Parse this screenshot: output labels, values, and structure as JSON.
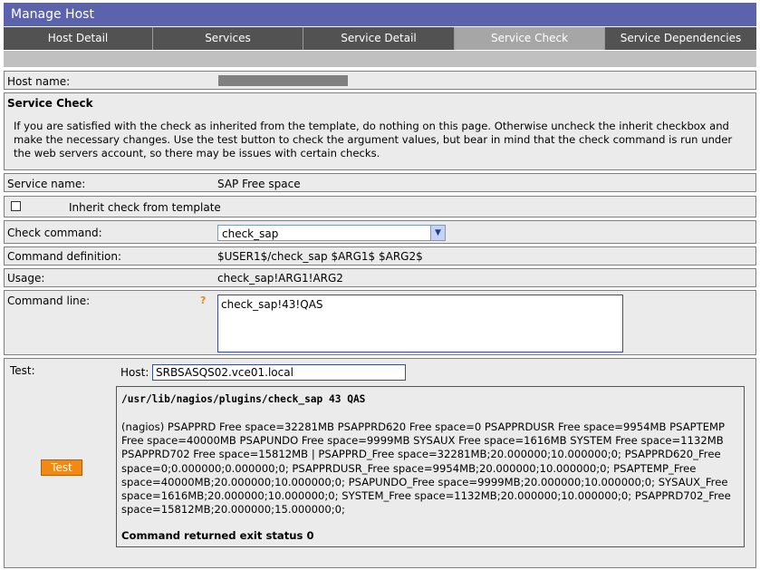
{
  "window": {
    "title": "Manage Host"
  },
  "tabs": [
    {
      "label": "Host Detail",
      "active": false
    },
    {
      "label": "Services",
      "active": false
    },
    {
      "label": "Service Detail",
      "active": false
    },
    {
      "label": "Service Check",
      "active": true
    },
    {
      "label": "Service Dependencies",
      "active": false
    }
  ],
  "host": {
    "label": "Host name:"
  },
  "service_check": {
    "title": "Service Check",
    "description": "If you are satisfied with the check as inherited from the template, do nothing on this page. Otherwise uncheck the inherit checkbox and make the necessary changes. Use the test button to check the argument values, but bear in mind that the check command is run under the web servers account, so there may be issues with certain checks."
  },
  "service_name": {
    "label": "Service name:",
    "value": "SAP Free space"
  },
  "inherit": {
    "label": "Inherit check from template",
    "checked": false
  },
  "check_command": {
    "label": "Check command:",
    "value": "check_sap"
  },
  "command_definition": {
    "label": "Command definition:",
    "value": "$USER1$/check_sap $ARG1$ $ARG2$"
  },
  "usage": {
    "label": "Usage:",
    "value": "check_sap!ARG1!ARG2"
  },
  "command_line": {
    "label": "Command line:",
    "help": "?",
    "value": "check_sap!43!QAS"
  },
  "test": {
    "label": "Test:",
    "host_label": "Host:",
    "host_value": "SRBSASQS02.vce01.local",
    "button_label": "Test",
    "output_path": "/usr/lib/nagios/plugins/check_sap 43 QAS",
    "output_text": "(nagios) PSAPPRD Free space=32281MB PSAPPRD620 Free space=0 PSAPPRDUSR Free space=9954MB PSAPTEMP Free space=40000MB PSAPUNDO Free space=9999MB SYSAUX Free space=1616MB SYSTEM Free space=1132MB PSAPPRD702 Free space=15812MB | PSAPPRD_Free space=32281MB;20.000000;10.000000;0; PSAPPRD620_Free space=0;0.000000;0.000000;0; PSAPPRDUSR_Free space=9954MB;20.000000;10.000000;0; PSAPTEMP_Free space=40000MB;20.000000;10.000000;0; PSAPUNDO_Free space=9999MB;20.000000;10.000000;0; SYSAUX_Free space=1616MB;20.000000;10.000000;0; SYSTEM_Free space=1132MB;20.000000;10.000000;0; PSAPPRD702_Free space=15812MB;20.000000;15.000000;0;",
    "output_status": "Command returned exit status 0"
  },
  "colors": {
    "title_bar": "#5b63ad",
    "tab": "#525252",
    "tab_active": "#a6a6a6",
    "row_bg": "#ebebeb",
    "test_button": "#f08a14"
  }
}
